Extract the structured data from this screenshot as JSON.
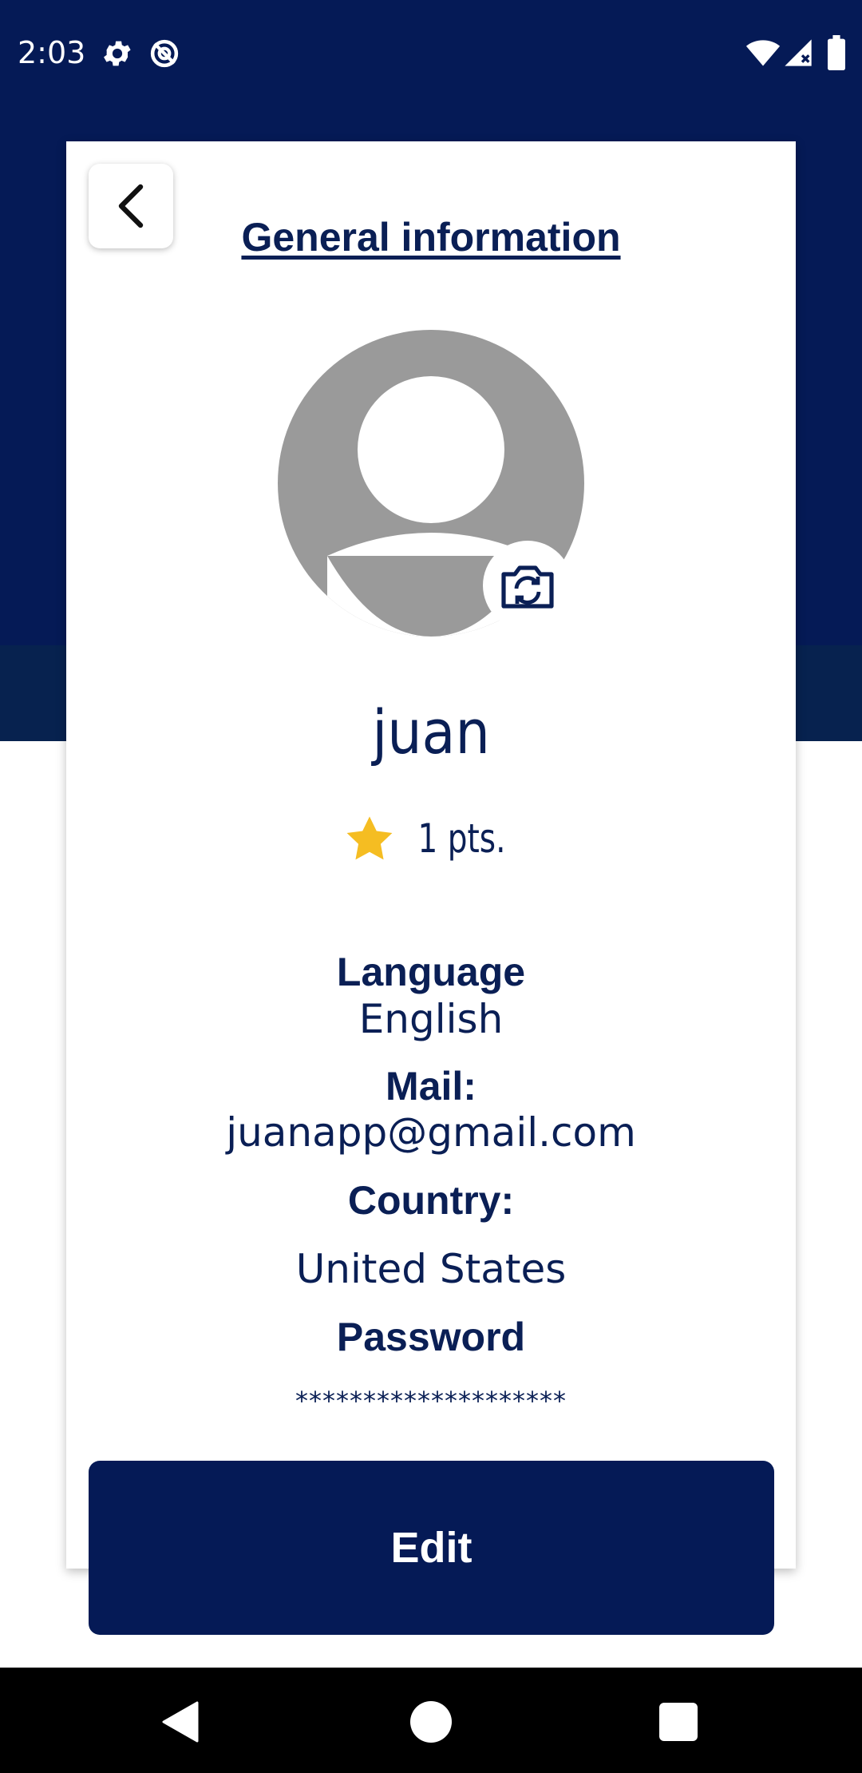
{
  "status_bar": {
    "time": "2:03",
    "icons_left": [
      "gear-icon",
      "data-saver-icon"
    ],
    "icons_right": [
      "wifi-icon",
      "signal-icon",
      "battery-icon"
    ]
  },
  "header": {
    "title": "General information",
    "back_icon": "chevron-left-icon"
  },
  "profile": {
    "avatar_icon": "user-avatar-icon",
    "camera_icon": "camera-switch-icon",
    "name": "juan",
    "points_icon": "star-icon",
    "points": "1 pts."
  },
  "info": {
    "language_label": "Language",
    "language_value": "English",
    "mail_label": "Mail:",
    "mail_value": "juanapp@gmail.com",
    "country_label": "Country:",
    "country_value": "United States",
    "password_label": "Password",
    "password_value": "********************"
  },
  "actions": {
    "edit_label": "Edit"
  },
  "colors": {
    "primary": "#051a56",
    "text": "#0a1f55",
    "star": "#f5bd22",
    "avatar": "#9a9a9a"
  },
  "nav_bar": {
    "buttons": [
      "back-triangle-icon",
      "home-circle-icon",
      "recents-square-icon"
    ]
  }
}
